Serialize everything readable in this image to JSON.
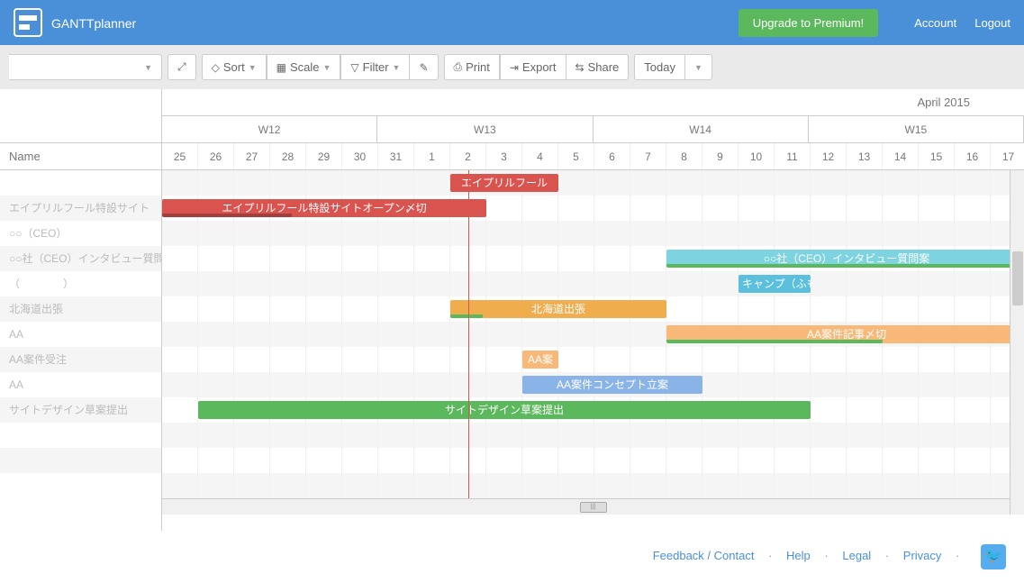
{
  "header": {
    "logo_main": "GANTT",
    "logo_sub": "planner",
    "upgrade": "Upgrade to Premium!",
    "account": "Account",
    "logout": "Logout"
  },
  "toolbar": {
    "sort": "Sort",
    "scale": "Scale",
    "filter": "Filter",
    "print": "Print",
    "export": "Export",
    "share": "Share",
    "today": "Today"
  },
  "timeline": {
    "month": "April 2015",
    "weeks": [
      "W12",
      "W13",
      "W14",
      "W15"
    ],
    "days": [
      "25",
      "26",
      "27",
      "28",
      "29",
      "30",
      "31",
      "1",
      "2",
      "3",
      "4",
      "5",
      "6",
      "7",
      "8",
      "9",
      "10",
      "11",
      "12",
      "13",
      "14",
      "15",
      "16",
      "17"
    ],
    "today_index": 8
  },
  "left_header": "Name",
  "rows": [
    {
      "label": "",
      "tasks": [
        {
          "start": 8,
          "span": 3,
          "color": "#d9534f",
          "text": "エイプリルフール"
        }
      ]
    },
    {
      "label": "エイプリルフール特設サイト",
      "tasks": [
        {
          "start": 0,
          "span": 9,
          "color": "#d9534f",
          "text": "エイプリルフール特設サイトオープン〆切",
          "progress": 40
        }
      ]
    },
    {
      "label": "○○（CEO）",
      "tasks": []
    },
    {
      "label": "○○社（CEO）インタビュー質問",
      "tasks": [
        {
          "start": 14,
          "span": 10,
          "color": "#7ed3e0",
          "text": "○○社（CEO）インタビュー質問案",
          "progress": 100,
          "progress_color": "green"
        }
      ]
    },
    {
      "label": "（　　　　）",
      "tasks": [
        {
          "start": 16,
          "span": 2,
          "color": "#5bc0de",
          "text": "キャンプ（ふも"
        }
      ]
    },
    {
      "label": "北海道出張",
      "tasks": [
        {
          "start": 8,
          "span": 6,
          "color": "#f0ad4e",
          "text": "北海道出張",
          "progress": 15,
          "progress_color": "green"
        }
      ]
    },
    {
      "label": "AA",
      "tasks": [
        {
          "start": 14,
          "span": 10,
          "color": "#f8b878",
          "text": "AA案件記事〆切",
          "progress": 60,
          "progress_color": "green"
        }
      ]
    },
    {
      "label": "AA案件受注",
      "tasks": [
        {
          "start": 10,
          "span": 1,
          "color": "#f8b878",
          "text": "AA案"
        }
      ]
    },
    {
      "label": "AA",
      "tasks": [
        {
          "start": 10,
          "span": 5,
          "color": "#8ab4e8",
          "text": "AA案件コンセプト立案"
        }
      ]
    },
    {
      "label": "サイトデザイン草案提出",
      "tasks": [
        {
          "start": 1,
          "span": 17,
          "color": "#5cb85c",
          "text": "サイトデザイン草案提出"
        }
      ]
    },
    {
      "label": "",
      "tasks": []
    },
    {
      "label": "",
      "tasks": []
    },
    {
      "label": "",
      "tasks": []
    }
  ],
  "footer": {
    "feedback": "Feedback / Contact",
    "help": "Help",
    "legal": "Legal",
    "privacy": "Privacy"
  }
}
